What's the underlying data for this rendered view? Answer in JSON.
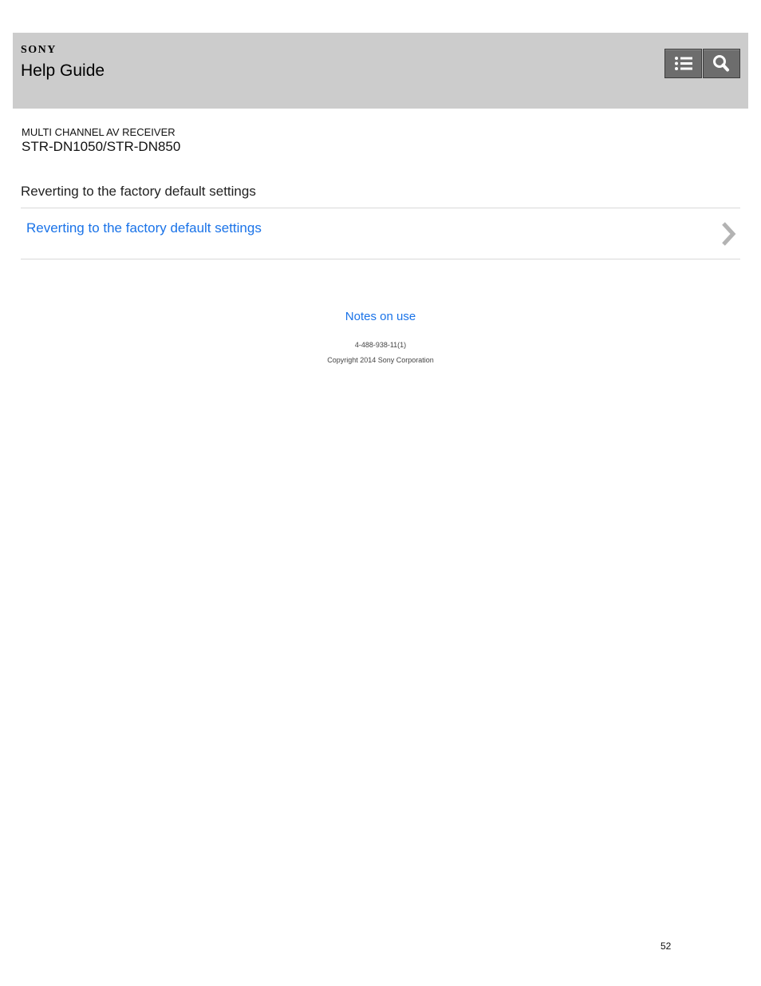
{
  "header": {
    "brand": "SONY",
    "title": "Help Guide",
    "toc_icon": "list-icon",
    "search_icon": "search-icon",
    "background_color": "#cccccc",
    "button_color": "#6d6d6d"
  },
  "product": {
    "category": "MULTI CHANNEL AV RECEIVER",
    "model": "STR-DN1050/STR-DN850"
  },
  "section": {
    "title": "Reverting to the factory default settings",
    "links": [
      {
        "label": "Reverting to the factory default settings",
        "icon": "chevron-right-icon"
      }
    ],
    "link_color": "#1a73e8"
  },
  "footer": {
    "notes_link": "Notes on use",
    "doc_code": "4-488-938-11(1)",
    "copyright": "Copyright 2014 Sony Corporation"
  },
  "page": {
    "number": "52"
  }
}
